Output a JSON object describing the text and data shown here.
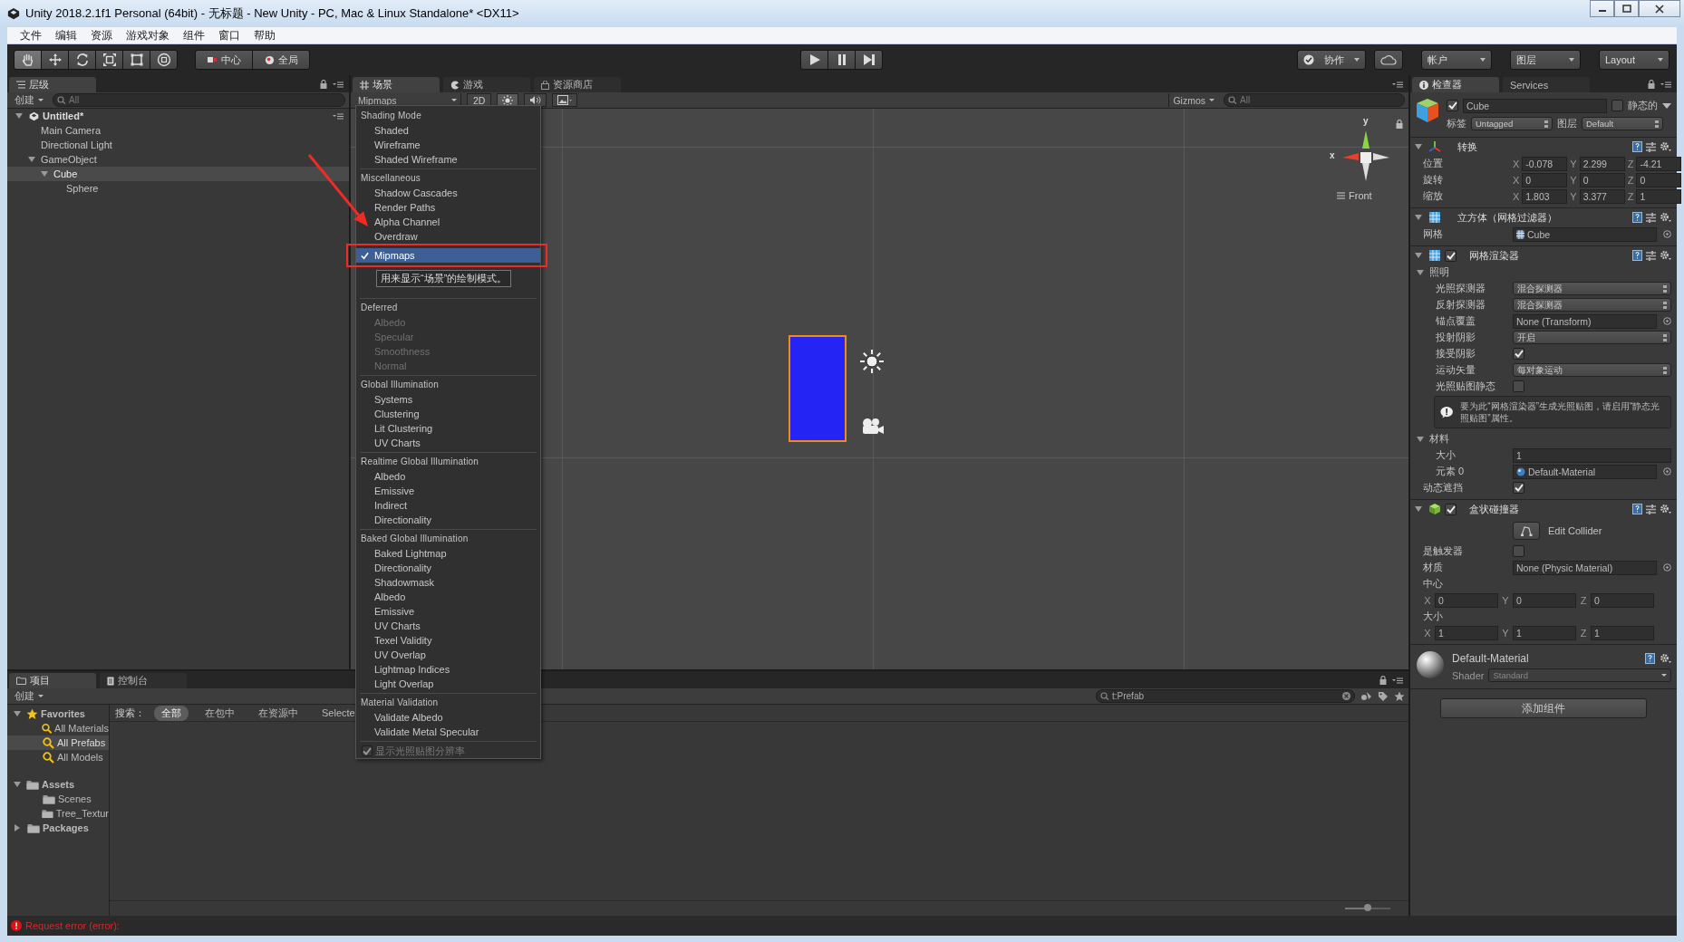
{
  "window": {
    "title": "Unity 2018.2.1f1 Personal (64bit) - 无标题 - New Unity - PC, Mac & Linux Standalone* <DX11>"
  },
  "menu": [
    "文件",
    "编辑",
    "资源",
    "游戏对象",
    "组件",
    "窗口",
    "帮助"
  ],
  "toolbar": {
    "tools": [
      {
        "kind": "hand",
        "selected": true
      },
      {
        "kind": "move",
        "selected": false
      },
      {
        "kind": "rotate",
        "selected": false
      },
      {
        "kind": "scale",
        "selected": false
      },
      {
        "kind": "rect",
        "selected": false
      },
      {
        "kind": "transform",
        "selected": false
      }
    ],
    "pivot": [
      {
        "kind": "pivot",
        "label": "中心"
      },
      {
        "kind": "global",
        "label": "全局"
      }
    ],
    "playback": [
      {
        "kind": "play",
        "selected": false
      },
      {
        "kind": "pause",
        "selected": false
      },
      {
        "kind": "step",
        "selected": false
      }
    ],
    "collab": "协作",
    "account": "帐户",
    "layers": "图层",
    "layout": "Layout"
  },
  "hierarchy": {
    "tab": "层级",
    "create": "创建",
    "search_placeholder": "All",
    "scene": "Untitled*",
    "items": [
      {
        "label": "Main Camera",
        "selected": false
      },
      {
        "label": "Directional Light",
        "selected": false
      },
      {
        "label": "GameObject",
        "selected": false,
        "expanded": true,
        "children": [
          {
            "label": "Cube",
            "selected": true,
            "expanded": true,
            "children": [
              {
                "label": "Sphere",
                "selected": false
              }
            ]
          }
        ]
      }
    ]
  },
  "scene": {
    "tabs": [
      {
        "kind": "scene",
        "label": "场景",
        "selected": true
      },
      {
        "kind": "game",
        "label": "游戏",
        "selected": false
      },
      {
        "kind": "store",
        "label": "资源商店",
        "selected": false
      }
    ],
    "draw_mode": "Mipmaps",
    "mode_2d": "2D",
    "toggles": [
      {
        "kind": "lighting",
        "on": true
      },
      {
        "kind": "audio",
        "on": false
      },
      {
        "kind": "effects",
        "on": false
      }
    ],
    "gizmos": "Gizmos",
    "search_placeholder": "All",
    "axis_labels": [
      "y",
      "x"
    ],
    "view_label": "Front"
  },
  "dropdown": {
    "sections": [
      {
        "header": "Shading Mode",
        "items": [
          {
            "label": "Shaded",
            "checked": false,
            "disabled": false
          },
          {
            "label": "Wireframe",
            "checked": false,
            "disabled": false
          },
          {
            "label": "Shaded Wireframe",
            "checked": false,
            "disabled": false
          }
        ]
      },
      {
        "header": "Miscellaneous",
        "tooltip": "用来显示“场景”的绘制模式。",
        "items": [
          {
            "label": "Shadow Cascades",
            "checked": false,
            "disabled": false
          },
          {
            "label": "Render Paths",
            "checked": false,
            "disabled": false
          },
          {
            "label": "Alpha Channel",
            "checked": false,
            "disabled": false
          },
          {
            "label": "Overdraw",
            "checked": false,
            "disabled": false
          },
          {
            "label": "Mipmaps",
            "checked": true,
            "disabled": false
          }
        ]
      },
      {
        "header": "Deferred",
        "items": [
          {
            "label": "Albedo",
            "checked": false,
            "disabled": true
          },
          {
            "label": "Specular",
            "checked": false,
            "disabled": true
          },
          {
            "label": "Smoothness",
            "checked": false,
            "disabled": true
          },
          {
            "label": "Normal",
            "checked": false,
            "disabled": true
          }
        ]
      },
      {
        "header": "Global Illumination",
        "items": [
          {
            "label": "Systems",
            "checked": false,
            "disabled": false
          },
          {
            "label": "Clustering",
            "checked": false,
            "disabled": false
          },
          {
            "label": "Lit Clustering",
            "checked": false,
            "disabled": false
          },
          {
            "label": "UV Charts",
            "checked": false,
            "disabled": false
          }
        ]
      },
      {
        "header": "Realtime Global Illumination",
        "items": [
          {
            "label": "Albedo",
            "checked": false,
            "disabled": false
          },
          {
            "label": "Emissive",
            "checked": false,
            "disabled": false
          },
          {
            "label": "Indirect",
            "checked": false,
            "disabled": false
          },
          {
            "label": "Directionality",
            "checked": false,
            "disabled": false
          }
        ]
      },
      {
        "header": "Baked Global Illumination",
        "items": [
          {
            "label": "Baked Lightmap",
            "checked": false,
            "disabled": false
          },
          {
            "label": "Directionality",
            "checked": false,
            "disabled": false
          },
          {
            "label": "Shadowmask",
            "checked": false,
            "disabled": false
          },
          {
            "label": "Albedo",
            "checked": false,
            "disabled": false
          },
          {
            "label": "Emissive",
            "checked": false,
            "disabled": false
          },
          {
            "label": "UV Charts",
            "checked": false,
            "disabled": false
          },
          {
            "label": "Texel Validity",
            "checked": false,
            "disabled": false
          },
          {
            "label": "UV Overlap",
            "checked": false,
            "disabled": false
          },
          {
            "label": "Lightmap Indices",
            "checked": false,
            "disabled": false
          },
          {
            "label": "Light Overlap",
            "checked": false,
            "disabled": false
          }
        ]
      },
      {
        "header": "Material Validation",
        "items": [
          {
            "label": "Validate Albedo",
            "checked": false,
            "disabled": false
          },
          {
            "label": "Validate Metal Specular",
            "checked": false,
            "disabled": false
          }
        ]
      }
    ],
    "footer": {
      "label": "显示光照贴图分辨率",
      "checked": true,
      "disabled": true
    }
  },
  "project": {
    "tabs": [
      {
        "kind": "project",
        "label": "项目",
        "selected": true
      },
      {
        "kind": "console",
        "label": "控制台",
        "selected": false
      }
    ],
    "create": "创建",
    "search_value": "t:Prefab",
    "tree": [
      {
        "kind": "favorites",
        "label": "Favorites",
        "expanded": true,
        "selected": false,
        "children": [
          {
            "kind": "search",
            "label": "All Materials",
            "selected": false
          },
          {
            "kind": "search",
            "label": "All Prefabs",
            "selected": true
          },
          {
            "kind": "search",
            "label": "All Models",
            "selected": false
          }
        ]
      },
      {
        "kind": "folder",
        "label": "Assets",
        "expanded": true,
        "selected": false,
        "children": [
          {
            "kind": "folder",
            "label": "Scenes",
            "selected": false
          },
          {
            "kind": "folder",
            "label": "Tree_Textur",
            "selected": false
          }
        ]
      },
      {
        "kind": "folder",
        "label": "Packages",
        "expanded": false,
        "selected": false
      }
    ],
    "search_label": "搜索：",
    "scopes": [
      {
        "label": "全部",
        "selected": true
      },
      {
        "label": "在包中",
        "selected": false
      },
      {
        "label": "在资源中",
        "selected": false
      },
      {
        "label": "Selecte",
        "selected": false
      }
    ],
    "thumbnail_slider": {
      "level": 0.5
    }
  },
  "inspector": {
    "tabs": [
      {
        "kind": "inspector",
        "label": "检查器",
        "selected": true
      },
      {
        "kind": "services",
        "label": "Services",
        "selected": false
      }
    ],
    "object": {
      "active": true,
      "name": "Cube",
      "static_label": "静态的",
      "static": false,
      "tag_label": "标签",
      "tag": "Untagged",
      "layer_label": "图层",
      "layer": "Default"
    },
    "components": [
      {
        "kind": "transform",
        "title": "转换",
        "expanded": true,
        "rows": [
          {
            "kind": "vector3",
            "label": "位置",
            "axes": [
              "X",
              "Y",
              "Z"
            ],
            "values": [
              "-0.078",
              "2.299",
              "-4.21"
            ]
          },
          {
            "kind": "vector3",
            "label": "旋转",
            "axes": [
              "X",
              "Y",
              "Z"
            ],
            "values": [
              "0",
              "0",
              "0"
            ]
          },
          {
            "kind": "vector3",
            "label": "缩放",
            "axes": [
              "X",
              "Y",
              "Z"
            ],
            "values": [
              "1.803",
              "3.377",
              "1"
            ]
          }
        ]
      },
      {
        "kind": "mesh_filter",
        "title": "立方体（网格过滤器）",
        "expanded": true,
        "rows": [
          {
            "kind": "mesh",
            "label": "网格",
            "value": "Cube"
          }
        ]
      },
      {
        "kind": "mesh_renderer",
        "title": "网格渲染器",
        "expanded": true,
        "enabled": true,
        "rows": [
          {
            "kind": "section",
            "label": "照明",
            "expanded": true,
            "children": [
              {
                "kind": "dropdown",
                "label": "光照探测器",
                "value": "混合探测器"
              },
              {
                "kind": "dropdown",
                "label": "反射探测器",
                "value": "混合探测器"
              },
              {
                "kind": "object",
                "label": "锚点覆盖",
                "value": "None (Transform)"
              },
              {
                "kind": "dropdown",
                "label": "投射阴影",
                "value": "开启"
              },
              {
                "kind": "checkbox",
                "label": "接受阴影",
                "checked": true
              },
              {
                "kind": "dropdown",
                "label": "运动矢量",
                "value": "每对象运动"
              },
              {
                "kind": "checkbox",
                "label": "光照贴图静态",
                "checked": false
              },
              {
                "kind": "note",
                "text": "要为此“网格渲染器”生成光照贴图，请启用“静态光照贴图”属性。"
              }
            ]
          },
          {
            "kind": "section",
            "label": "材料",
            "expanded": true,
            "children": [
              {
                "kind": "field",
                "label": "大小",
                "value": "1"
              },
              {
                "kind": "material",
                "label": "元素 0",
                "value": "Default-Material"
              }
            ]
          },
          {
            "kind": "checkbox",
            "label": "动态遮挡",
            "checked": true
          }
        ]
      },
      {
        "kind": "box_collider",
        "title": "盒状碰撞器",
        "expanded": true,
        "enabled": true,
        "rows": [
          {
            "kind": "button",
            "label": "Edit Collider"
          },
          {
            "kind": "checkbox",
            "label": "是触发器",
            "checked": false
          },
          {
            "kind": "object",
            "label": "材质",
            "value": "None (Physic Material)"
          },
          {
            "kind": "vector3_below",
            "label": "中心",
            "axes": [
              "X",
              "Y",
              "Z"
            ],
            "values": [
              "0",
              "0",
              "0"
            ]
          },
          {
            "kind": "vector3_below",
            "label": "大小",
            "axes": [
              "X",
              "Y",
              "Z"
            ],
            "values": [
              "1",
              "1",
              "1"
            ]
          }
        ]
      }
    ],
    "material": {
      "name": "Default-Material",
      "shader_label": "Shader",
      "shader": "Standard"
    },
    "add_button": "添加组件"
  },
  "status": {
    "kind": "error",
    "message": "Request error (error):"
  }
}
